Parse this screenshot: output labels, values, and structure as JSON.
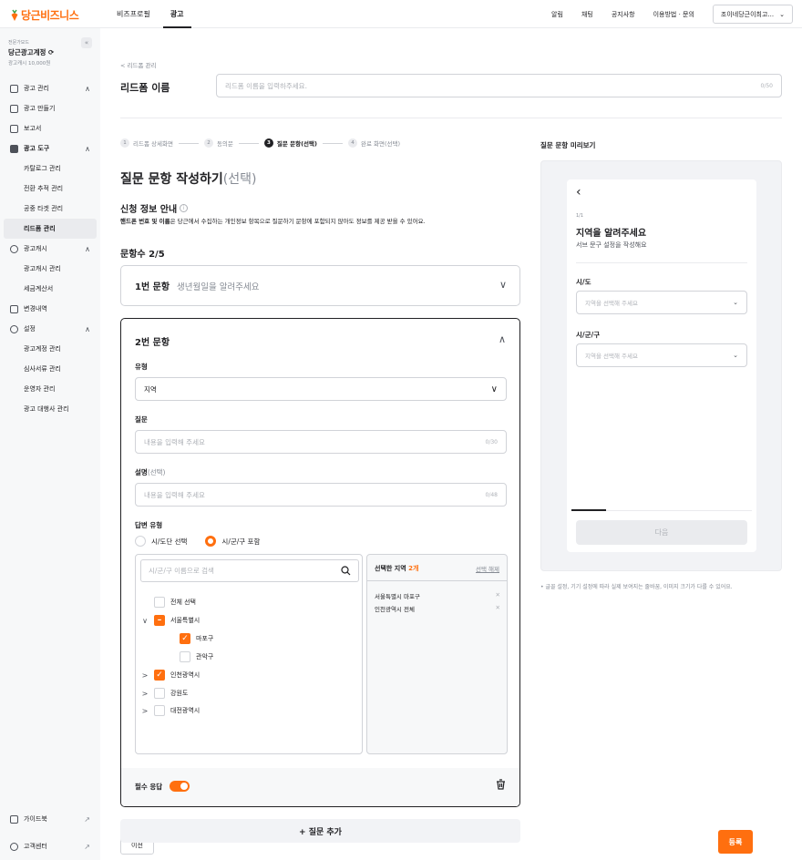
{
  "brand": {
    "name": "당근비즈니스",
    "accent": "#ff6f0f"
  },
  "topnav": {
    "items": [
      "비즈프로필",
      "광고"
    ],
    "active": "광고"
  },
  "topright": {
    "links": [
      "알림",
      "채팅",
      "공지사항",
      "이용방법 · 문의"
    ],
    "account": "조이네당근이최고..."
  },
  "sidebar": {
    "account_label": "전문가모드",
    "account_name": "당근광고계정",
    "cash": "광고캐시 10,000원",
    "collapse": "«",
    "menu": [
      {
        "label": "광고 관리",
        "type": "top",
        "chev": "∧"
      },
      {
        "label": "광고 만들기",
        "type": "top"
      },
      {
        "label": "보고서",
        "type": "top"
      },
      {
        "label": "광고 도구",
        "type": "top",
        "chev": "∧"
      },
      {
        "label": "카탈로그 관리",
        "type": "sub"
      },
      {
        "label": "전환 추적 관리",
        "type": "sub"
      },
      {
        "label": "공중 타겟 관리",
        "type": "sub"
      },
      {
        "label": "리드폼 관리",
        "type": "sub",
        "selected": true
      },
      {
        "label": "광고캐시",
        "type": "top",
        "chev": "∧"
      },
      {
        "label": "광고캐시 관리",
        "type": "sub"
      },
      {
        "label": "세금계산서",
        "type": "sub"
      },
      {
        "label": "변경내역",
        "type": "top"
      },
      {
        "label": "설정",
        "type": "top",
        "chev": "∧"
      },
      {
        "label": "광고계정 관리",
        "type": "sub"
      },
      {
        "label": "심사서류 관리",
        "type": "sub"
      },
      {
        "label": "운영자 관리",
        "type": "sub"
      },
      {
        "label": "광고 대행사 관리",
        "type": "sub"
      }
    ],
    "bottom": [
      {
        "label": "가이드북",
        "arrow": "↗"
      },
      {
        "label": "고객센터",
        "arrow": "↗"
      }
    ]
  },
  "leadform": {
    "back": "< 리드폼 관리",
    "label": "리드폼 이름",
    "placeholder": "리드폼 이름을 입력하주세요.",
    "counter": "0/50"
  },
  "steps": [
    {
      "n": "1",
      "label": "리드폼 상세화면"
    },
    {
      "n": "2",
      "label": "동의문"
    },
    {
      "n": "3",
      "label": "질문 문항(선택)",
      "current": true
    },
    {
      "n": "4",
      "label": "완료 화면(선택)"
    }
  ],
  "heading": {
    "main": "질문 문항 작성하기",
    "opt": "(선택)"
  },
  "info": {
    "title": "신청 정보 안내",
    "icon": "ⓘ",
    "bold": "핸드폰 번호 및 이름",
    "rest": "은 당근에서 수집하는 개인정보 항목으로  질문하기 문항에 포함되지 않아도 정보를 제공 받을 수 있어요."
  },
  "count": "문항수 2/5",
  "q1": {
    "num": "1번 문항",
    "placeholder": "생년월일을 알려주세요"
  },
  "q2": {
    "num": "2번 문항",
    "type_label": "유형",
    "type_value": "지역",
    "question_label": "질문",
    "question_ph": "내용을 입력해 주세요",
    "question_cnt": "0/30",
    "desc_label": "설명",
    "desc_opt": "(선택)",
    "desc_ph": "내용을 입력해 주세요",
    "desc_cnt": "0/48",
    "answer_label": "답변 유형",
    "radio1": "시/도단 선택",
    "radio2": "시/군/구 포함",
    "search_ph": "시/군/구 이름으로 검색",
    "tree": [
      {
        "label": "전체 선택",
        "state": "off",
        "level": 0,
        "chev": ""
      },
      {
        "label": "서울특별시",
        "state": "partial",
        "level": 0,
        "chev": "∨"
      },
      {
        "label": "마포구",
        "state": "on",
        "level": 1,
        "chev": ""
      },
      {
        "label": "관악구",
        "state": "off",
        "level": 1,
        "chev": ""
      },
      {
        "label": "인천광역시",
        "state": "on",
        "level": 0,
        "chev": ">"
      },
      {
        "label": "강원도",
        "state": "off",
        "level": 0,
        "chev": ">"
      },
      {
        "label": "대전광역시",
        "state": "off",
        "level": 0,
        "chev": ">"
      }
    ],
    "selected_head": "선택한 지역",
    "selected_count": "2개",
    "clear": "선택 해제",
    "selected": [
      "서울특별시 마포구",
      "인천광역시 전체"
    ],
    "required": "필수 응답"
  },
  "add_question": "+ 질문 추가",
  "prev": "이전",
  "submit": "등록",
  "preview": {
    "title": "질문 문항 미리보기",
    "page": "1/1",
    "heading": "지역을 알려주세요",
    "sub": "서브 문구 설정을 작성해요",
    "f1_label": "시/도",
    "f1_ph": "지역을 선택해 주세요",
    "f2_label": "시/군/구",
    "f2_ph": "지역을 선택해 주세요",
    "next": "다음",
    "note": "• 글꼴 설정, 기기 설정에 따라 실제 보여지는 줄바꿈, 이미지 크기가 다를 수 있어요."
  }
}
